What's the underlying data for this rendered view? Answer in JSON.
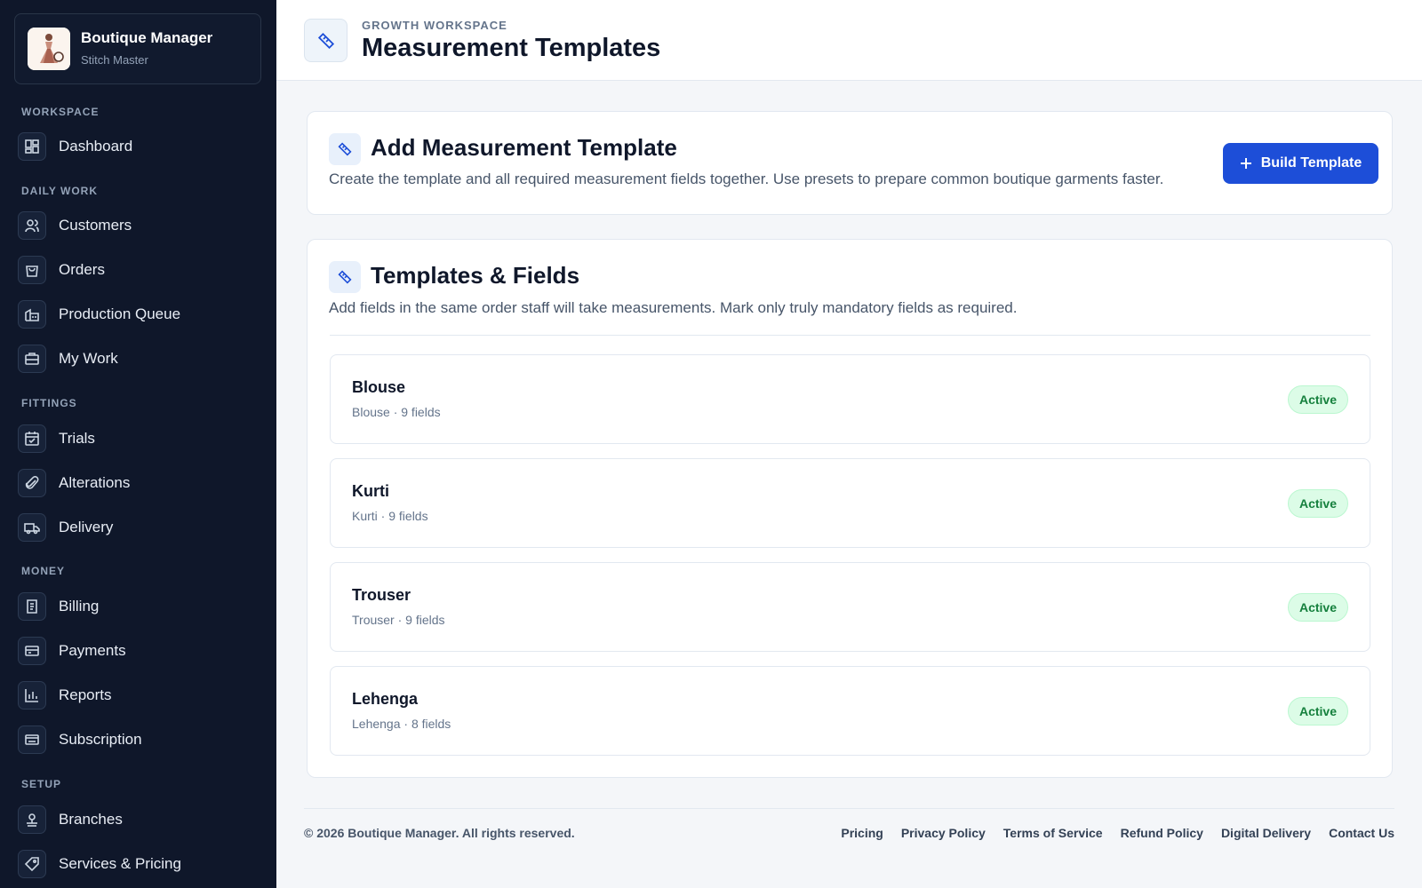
{
  "brand": {
    "title": "Boutique Manager",
    "subtitle": "Stitch Master",
    "logo_icon": "dress-logo-icon"
  },
  "sidebar": {
    "sections": [
      {
        "label": "WORKSPACE",
        "items": [
          {
            "label": "Dashboard",
            "icon": "dashboard-icon"
          }
        ]
      },
      {
        "label": "DAILY WORK",
        "items": [
          {
            "label": "Customers",
            "icon": "users-icon"
          },
          {
            "label": "Orders",
            "icon": "shopping-bag-icon"
          },
          {
            "label": "Production Queue",
            "icon": "factory-icon"
          },
          {
            "label": "My Work",
            "icon": "briefcase-icon"
          }
        ]
      },
      {
        "label": "FITTINGS",
        "items": [
          {
            "label": "Trials",
            "icon": "calendar-check-icon"
          },
          {
            "label": "Alterations",
            "icon": "paperclip-icon"
          },
          {
            "label": "Delivery",
            "icon": "truck-icon"
          }
        ]
      },
      {
        "label": "MONEY",
        "items": [
          {
            "label": "Billing",
            "icon": "receipt-icon"
          },
          {
            "label": "Payments",
            "icon": "credit-card-icon"
          },
          {
            "label": "Reports",
            "icon": "bar-chart-icon"
          },
          {
            "label": "Subscription",
            "icon": "subscription-card-icon"
          }
        ]
      },
      {
        "label": "SETUP",
        "items": [
          {
            "label": "Branches",
            "icon": "branch-icon"
          },
          {
            "label": "Services & Pricing",
            "icon": "tag-icon"
          }
        ]
      }
    ]
  },
  "header": {
    "eyebrow": "GROWTH WORKSPACE",
    "title": "Measurement Templates",
    "icon": "ruler-icon"
  },
  "add_card": {
    "title": "Add Measurement Template",
    "description": "Create the template and all required measurement fields together. Use presets to prepare common boutique garments faster.",
    "button_label": "Build Template"
  },
  "templates_card": {
    "title": "Templates & Fields",
    "description": "Add fields in the same order staff will take measurements. Mark only truly mandatory fields as required.",
    "templates": [
      {
        "name": "Blouse",
        "meta": "Blouse · 9 fields",
        "status": "Active"
      },
      {
        "name": "Kurti",
        "meta": "Kurti · 9 fields",
        "status": "Active"
      },
      {
        "name": "Trouser",
        "meta": "Trouser · 9 fields",
        "status": "Active"
      },
      {
        "name": "Lehenga",
        "meta": "Lehenga · 8 fields",
        "status": "Active"
      }
    ]
  },
  "footer": {
    "copyright": "© 2026 Boutique Manager. All rights reserved.",
    "links": [
      "Pricing",
      "Privacy Policy",
      "Terms of Service",
      "Refund Policy",
      "Digital Delivery",
      "Contact Us"
    ]
  },
  "colors": {
    "sidebar_bg": "#0f172a",
    "accent": "#1d4ed8",
    "active_badge": "#15803d"
  }
}
